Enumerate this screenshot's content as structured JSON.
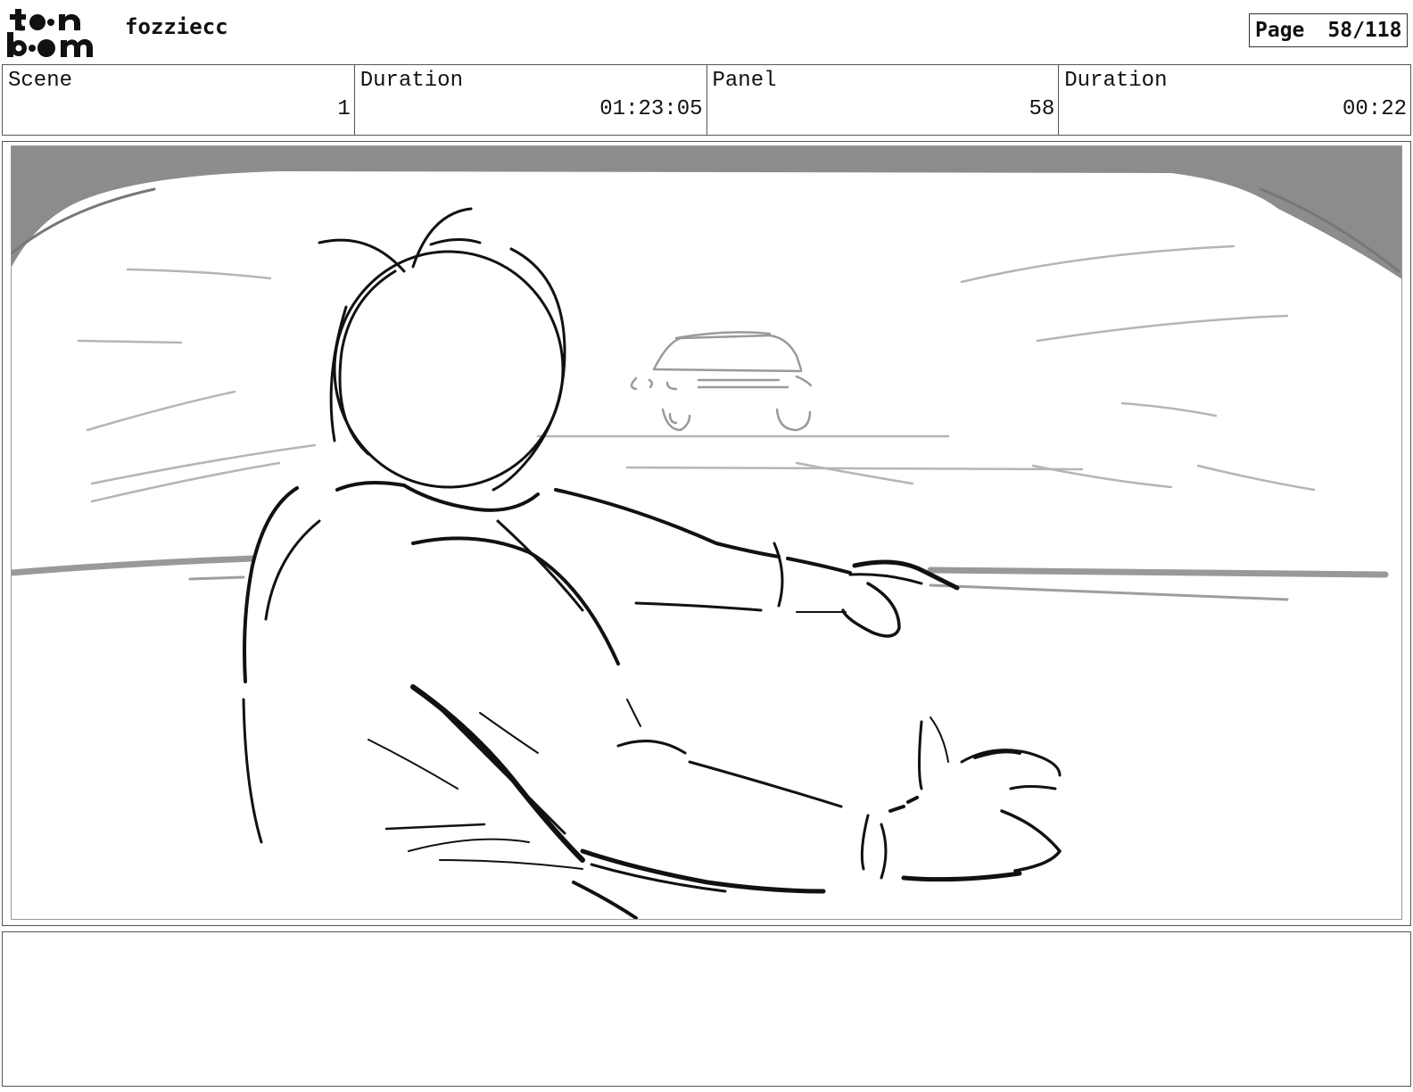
{
  "header": {
    "logo_text": "toon boom",
    "project_name": "fozziecc",
    "page_label": "Page",
    "page_number": "58/118"
  },
  "info": {
    "scene_label": "Scene",
    "scene_value": "1",
    "scene_duration_label": "Duration",
    "scene_duration_value": "01:23:05",
    "panel_label": "Panel",
    "panel_value": "58",
    "panel_duration_label": "Duration",
    "panel_duration_value": "00:22"
  },
  "notes": {
    "text": ""
  }
}
